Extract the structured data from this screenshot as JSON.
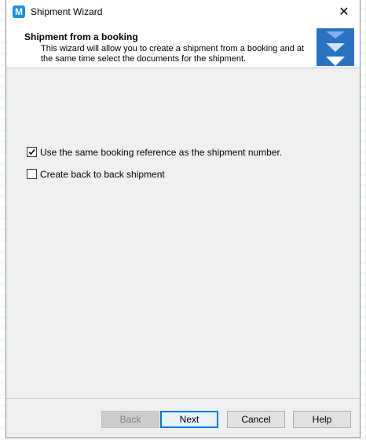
{
  "window": {
    "title": "Shipment Wizard",
    "app_icon_letter": "M",
    "close_glyph": "✕"
  },
  "header": {
    "title": "Shipment from a booking",
    "description": "This wizard will allow you to create a shipment from a booking and at the same time select the documents for the shipment."
  },
  "options": {
    "same_reference": {
      "label": "Use the same booking reference as the shipment number.",
      "checked": true
    },
    "back_to_back": {
      "label": "Create back to back shipment",
      "checked": false
    }
  },
  "buttons": {
    "back": "Back",
    "next": "Next",
    "cancel": "Cancel",
    "help": "Help"
  },
  "icons": {
    "app": "app-logo-icon",
    "close": "close-icon",
    "header_graphic": "chevron-down-stack-icon",
    "checkmark": "checkmark-icon"
  },
  "colors": {
    "accent": "#0078d7",
    "header_graphic": "#2a72c2",
    "app_icon": "#1e8fe0"
  }
}
